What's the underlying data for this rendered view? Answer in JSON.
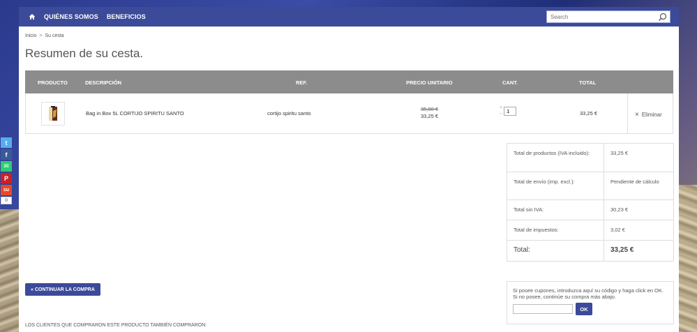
{
  "nav": {
    "home_icon": "home-icon",
    "links": [
      "QUIÉNES SOMOS",
      "BENEFICIOS"
    ],
    "search_placeholder": "Search"
  },
  "breadcrumb": {
    "home": "Inicio",
    "separator": ">",
    "current": "Su cesta"
  },
  "page_title": "Resumen de su cesta.",
  "cart": {
    "headers": {
      "product": "PRODUCTO",
      "description": "DESCRIPCIÓN",
      "ref": "REF.",
      "unit_price": "PRECIO UNITARIO",
      "qty": "CANT.",
      "total": "TOTAL"
    },
    "rows": [
      {
        "description": "Bag in Box 5L CORTIJO SPIRITU SANTO",
        "ref": "cortijo spiritu santo",
        "old_price": "35,00 €",
        "price": "33,25 €",
        "qty": "1",
        "total": "33,25 €",
        "remove_label": "Eliminar"
      }
    ]
  },
  "totals": [
    {
      "label": "Total de productos (IVA incluido):",
      "value": "33,25 €"
    },
    {
      "label": "Total de envío (imp. excl.):",
      "value": "Pendiente de cálculo"
    },
    {
      "label": "Total sin IVA:",
      "value": "30,23 €"
    },
    {
      "label": "Total de impuestos:",
      "value": "3,02 €"
    },
    {
      "label": "Total:",
      "value": "33,25 €"
    }
  ],
  "continue_button": "« CONTINUAR LA COMPRA",
  "coupon": {
    "text": "Si posee cupones, introduzca aquí su código y haga click en OK. Si no posee, continúe su compra más abajo.",
    "ok_label": "OK"
  },
  "also_bought": "LOS CLIENTES QUE COMPRARON ESTE PRODUCTO TAMBIÉN COMPRARON:",
  "social": {
    "count": "0",
    "buttons": [
      {
        "icon": "twitter-icon",
        "glyph": "t",
        "color": "#55acee"
      },
      {
        "icon": "facebook-icon",
        "glyph": "f",
        "color": "#3b5998"
      },
      {
        "icon": "email-icon",
        "glyph": "✉",
        "color": "#2ecc71"
      },
      {
        "icon": "pinterest-icon",
        "glyph": "P",
        "color": "#cb2027"
      },
      {
        "icon": "stumbleupon-icon",
        "glyph": "su",
        "color": "#eb4924"
      }
    ]
  },
  "colors": {
    "nav": "#3c4a9a",
    "table_header": "#8c8c8c",
    "button": "#3c4a9a"
  }
}
